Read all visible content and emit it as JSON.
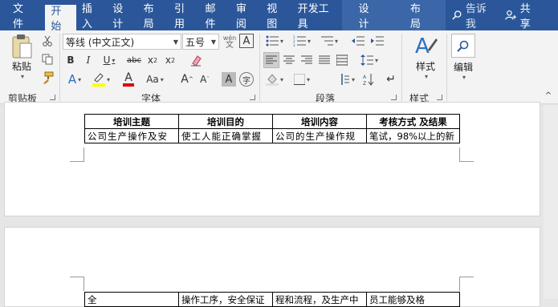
{
  "tabs": [
    {
      "label": "文件",
      "active": false
    },
    {
      "label": "开始",
      "active": true
    },
    {
      "label": "插入",
      "active": false
    },
    {
      "label": "设计",
      "active": false
    },
    {
      "label": "布局",
      "active": false
    },
    {
      "label": "引用",
      "active": false
    },
    {
      "label": "邮件",
      "active": false
    },
    {
      "label": "审阅",
      "active": false
    },
    {
      "label": "视图",
      "active": false
    },
    {
      "label": "开发工具",
      "active": false
    },
    {
      "label": "设计",
      "active": false
    },
    {
      "label": "布局",
      "active": false
    }
  ],
  "tellme": {
    "label": "告诉我"
  },
  "share": {
    "label": "共享"
  },
  "ribbon": {
    "clipboard": {
      "paste_label": "粘贴",
      "group_label": "剪贴板"
    },
    "font": {
      "font_name": "等线 (中文正文)",
      "font_size": "五号",
      "group_label": "字体",
      "phonetic": "wén文"
    },
    "paragraph": {
      "group_label": "段落"
    },
    "styles": {
      "label": "样式",
      "group_label": "样式"
    },
    "editing": {
      "label": "编辑"
    }
  },
  "table1": {
    "headers": [
      "培训主题",
      "培训目的",
      "培训内容",
      "考核方式 及结果"
    ],
    "row": [
      "公司生产操作及安",
      "使工人能正确掌握",
      "公司的生产操作规",
      "笔试，98%以上的新"
    ]
  },
  "table2": {
    "row": [
      "全",
      "操作工序，安全保证",
      "程和流程，及生产中",
      "员工能够及格"
    ]
  },
  "colors": {
    "accent": "#2b579a",
    "highlight": "#ffff00",
    "font_color": "#e00000"
  }
}
